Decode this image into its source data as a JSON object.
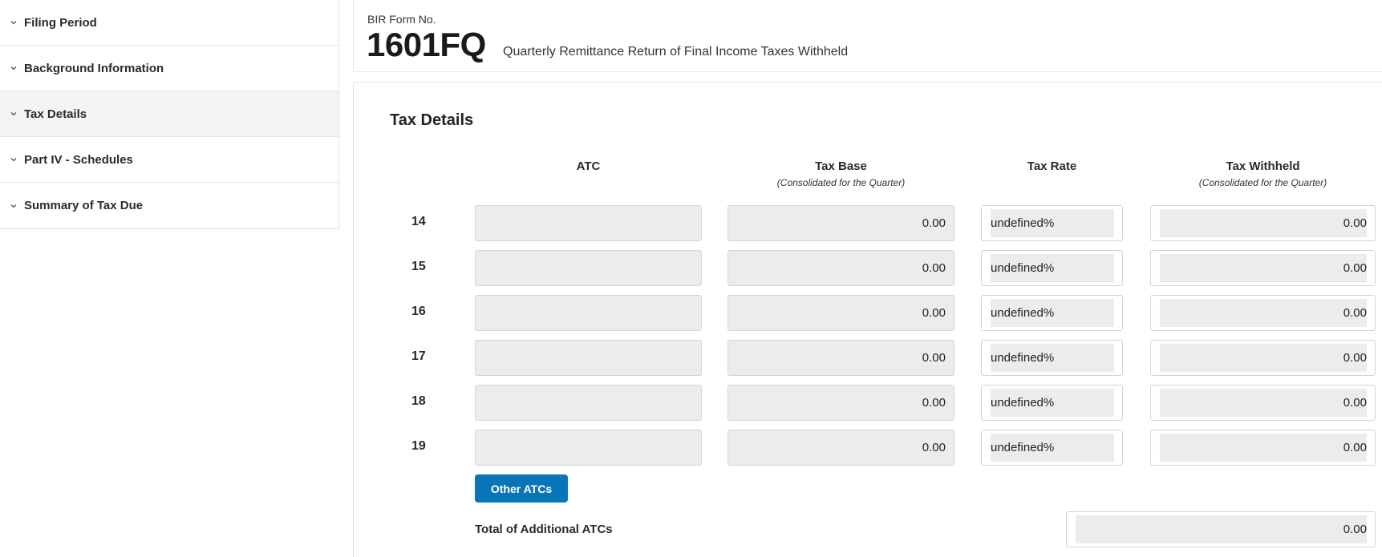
{
  "sidebar": {
    "items": [
      {
        "label": "Filing Period"
      },
      {
        "label": "Background Information"
      },
      {
        "label": "Tax Details"
      },
      {
        "label": "Part IV - Schedules"
      },
      {
        "label": "Summary of Tax Due"
      }
    ],
    "active_index": 2
  },
  "header": {
    "form_no_label": "BIR Form No.",
    "form_code": "1601FQ",
    "form_title": "Quarterly Remittance Return of Final Income Taxes Withheld"
  },
  "tax_details": {
    "title": "Tax Details",
    "columns": {
      "atc": {
        "label": "ATC"
      },
      "tax_base": {
        "label": "Tax Base",
        "sub": "(Consolidated for the Quarter)"
      },
      "tax_rate": {
        "label": "Tax Rate"
      },
      "tax_withheld": {
        "label": "Tax Withheld",
        "sub": "(Consolidated for the Quarter)"
      }
    },
    "rows": [
      {
        "num": "14",
        "atc": "",
        "tax_base": "0.00",
        "tax_rate": "undefined%",
        "tax_withheld": "0.00"
      },
      {
        "num": "15",
        "atc": "",
        "tax_base": "0.00",
        "tax_rate": "undefined%",
        "tax_withheld": "0.00"
      },
      {
        "num": "16",
        "atc": "",
        "tax_base": "0.00",
        "tax_rate": "undefined%",
        "tax_withheld": "0.00"
      },
      {
        "num": "17",
        "atc": "",
        "tax_base": "0.00",
        "tax_rate": "undefined%",
        "tax_withheld": "0.00"
      },
      {
        "num": "18",
        "atc": "",
        "tax_base": "0.00",
        "tax_rate": "undefined%",
        "tax_withheld": "0.00"
      },
      {
        "num": "19",
        "atc": "",
        "tax_base": "0.00",
        "tax_rate": "undefined%",
        "tax_withheld": "0.00"
      }
    ],
    "other_atcs_button": "Other ATCs",
    "total_label": "Total of Additional ATCs",
    "total_value": "0.00"
  },
  "colors": {
    "button_bg": "#0a74b8",
    "field_bg": "#ececec",
    "active_item_bg": "#f4f4f4"
  }
}
